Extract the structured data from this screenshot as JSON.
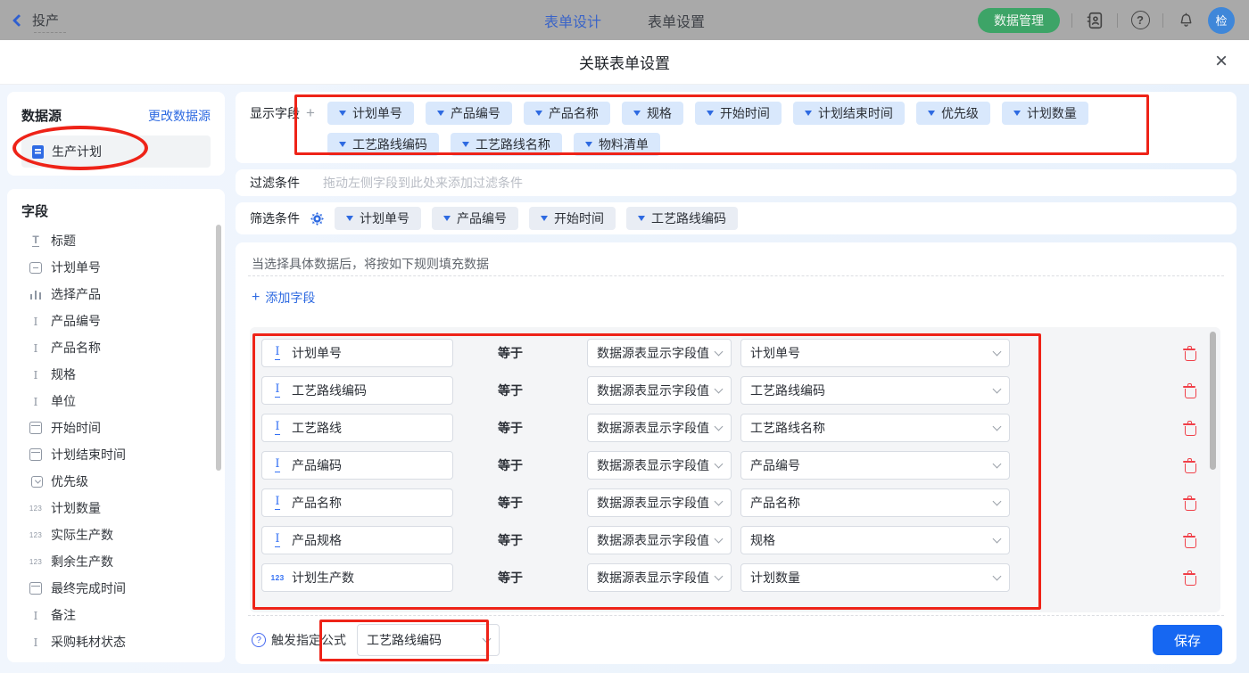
{
  "topbar": {
    "back_label": "投产",
    "tabs": [
      {
        "label": "表单设计"
      },
      {
        "label": "表单设置"
      }
    ],
    "data_manage_label": "数据管理",
    "avatar_label": "检",
    "icons": [
      "address-book-icon",
      "help-icon",
      "bell-icon"
    ]
  },
  "modal": {
    "title": "关联表单设置",
    "close_glyph": "×"
  },
  "sidebar": {
    "datasource_title": "数据源",
    "change_datasource_link": "更改数据源",
    "datasource_item": "生产计划",
    "fields_title": "字段",
    "field_items": [
      {
        "icon": "title-icon",
        "label": "标题"
      },
      {
        "icon": "input-icon",
        "label": "计划单号"
      },
      {
        "icon": "chart-icon",
        "label": "选择产品"
      },
      {
        "icon": "text-icon",
        "label": "产品编号"
      },
      {
        "icon": "text-icon",
        "label": "产品名称"
      },
      {
        "icon": "text-icon",
        "label": "规格"
      },
      {
        "icon": "text-icon",
        "label": "单位"
      },
      {
        "icon": "date-icon",
        "label": "开始时间"
      },
      {
        "icon": "date-icon",
        "label": "计划结束时间"
      },
      {
        "icon": "select-icon",
        "label": "优先级"
      },
      {
        "icon": "number-icon",
        "label": "计划数量"
      },
      {
        "icon": "number-icon",
        "label": "实际生产数"
      },
      {
        "icon": "number-icon",
        "label": "剩余生产数"
      },
      {
        "icon": "date-icon",
        "label": "最终完成时间"
      },
      {
        "icon": "text-icon",
        "label": "备注"
      },
      {
        "icon": "text-icon",
        "label": "采购耗材状态"
      }
    ]
  },
  "display_fields": {
    "label": "显示字段",
    "add_glyph": "+",
    "tags": [
      "计划单号",
      "产品编号",
      "产品名称",
      "规格",
      "开始时间",
      "计划结束时间",
      "优先级",
      "计划数量",
      "工艺路线编码",
      "工艺路线名称",
      "物料清单"
    ]
  },
  "filter": {
    "label": "过滤条件",
    "placeholder": "拖动左侧字段到此处来添加过滤条件"
  },
  "sift": {
    "label": "筛选条件",
    "tags": [
      "计划单号",
      "产品编号",
      "开始时间",
      "工艺路线编码"
    ]
  },
  "rules": {
    "hint": "当选择具体数据后，将按如下规则填充数据",
    "add_glyph": "+",
    "add_field_label": "添加字段",
    "operator": "等于",
    "source_option": "数据源表显示字段值",
    "rows": [
      {
        "icon": "text-icon",
        "field": "计划单号",
        "value": "计划单号"
      },
      {
        "icon": "text-icon",
        "field": "工艺路线编码",
        "value": "工艺路线编码"
      },
      {
        "icon": "text-icon",
        "field": "工艺路线",
        "value": "工艺路线名称"
      },
      {
        "icon": "text-icon",
        "field": "产品编码",
        "value": "产品编号"
      },
      {
        "icon": "text-icon",
        "field": "产品名称",
        "value": "产品名称"
      },
      {
        "icon": "text-icon",
        "field": "产品规格",
        "value": "规格"
      },
      {
        "icon": "number-icon",
        "field": "计划生产数",
        "value": "计划数量"
      }
    ]
  },
  "footer": {
    "help_glyph": "?",
    "trigger_label": "触发指定公式",
    "trigger_value": "工艺路线编码",
    "save_label": "保存"
  },
  "colors": {
    "accent_blue": "#2e6ae1",
    "primary_blue": "#1667f2",
    "green": "#3da467",
    "annotation_red": "#ee2318",
    "tag_blue_bg": "#d9e8fc",
    "tag_gray_bg": "#e9edf4"
  }
}
